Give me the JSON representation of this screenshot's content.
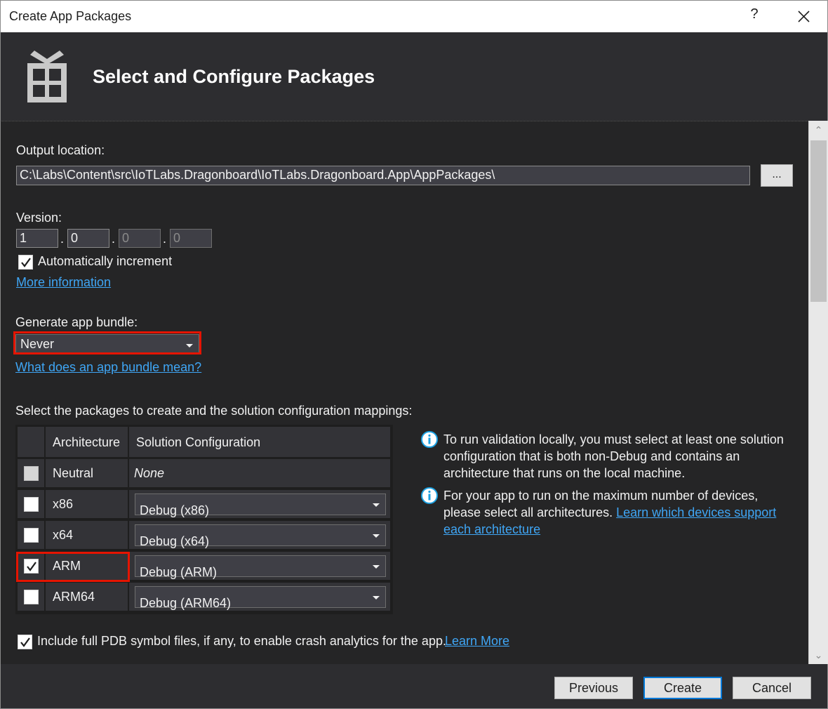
{
  "window": {
    "title": "Create App Packages",
    "help_label": "?"
  },
  "header": {
    "heading": "Select and Configure Packages"
  },
  "output": {
    "label": "Output location:",
    "value": "C:\\Labs\\Content\\src\\IoTLabs.Dragonboard\\IoTLabs.Dragonboard.App\\AppPackages\\",
    "browse_label": "..."
  },
  "version": {
    "label": "Version:",
    "parts": [
      "1",
      "0",
      "0",
      "0"
    ],
    "separator": ".",
    "auto_increment_label": "Automatically increment",
    "auto_increment_checked": true,
    "more_info_link": "More information"
  },
  "bundle": {
    "label": "Generate app bundle:",
    "selected": "Never",
    "help_link": "What does an app bundle mean?"
  },
  "packages": {
    "label": "Select the packages to create and the solution configuration mappings:",
    "columns": [
      "Architecture",
      "Solution Configuration"
    ],
    "rows": [
      {
        "checked": false,
        "disabled": true,
        "architecture": "Neutral",
        "configuration": "None"
      },
      {
        "checked": false,
        "disabled": false,
        "architecture": "x86",
        "configuration": "Debug (x86)"
      },
      {
        "checked": false,
        "disabled": false,
        "architecture": "x64",
        "configuration": "Debug (x64)"
      },
      {
        "checked": true,
        "disabled": false,
        "architecture": "ARM",
        "configuration": "Debug (ARM)"
      },
      {
        "checked": false,
        "disabled": false,
        "architecture": "ARM64",
        "configuration": "Debug (ARM64)"
      }
    ]
  },
  "info": {
    "note1": "To run validation locally, you must select at least one solution configuration that is both non-Debug and contains an architecture that runs on the local machine.",
    "note2_text": "For your app to run on the maximum number of devices, please select all architectures.",
    "note2_link": "Learn which devices support each architecture"
  },
  "pdb": {
    "label": "Include full PDB symbol files, if any, to enable crash analytics for the app.",
    "checked": true,
    "link": "Learn More"
  },
  "footer": {
    "previous_label": "Previous",
    "create_label": "Create",
    "cancel_label": "Cancel"
  },
  "colors": {
    "background": "#2d2d30",
    "content_background": "#252526",
    "link": "#3fa6f5",
    "highlight": "#e51400",
    "info_icon": "#1ba1e2"
  }
}
